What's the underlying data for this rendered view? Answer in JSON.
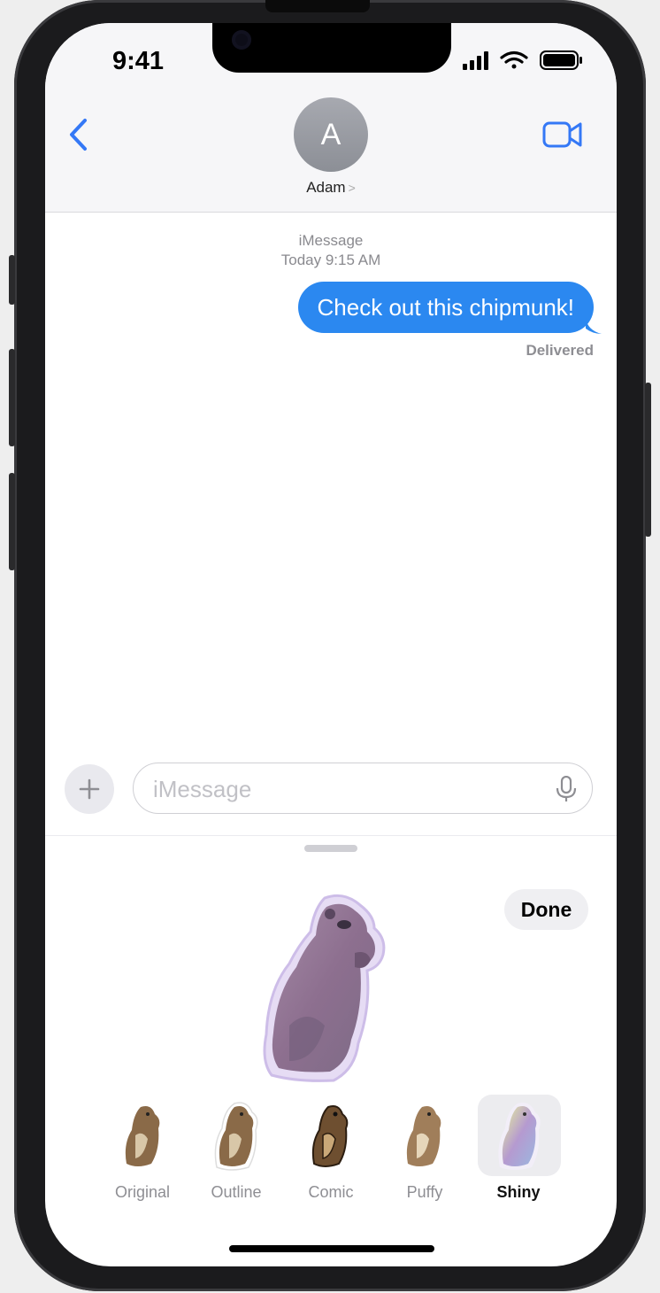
{
  "status_bar": {
    "time": "9:41"
  },
  "header": {
    "avatar_initial": "A",
    "contact_name": "Adam",
    "name_chevron": ">",
    "back_icon": "chevron-left-icon",
    "video_icon": "video-camera-icon"
  },
  "thread": {
    "service": "iMessage",
    "timestamp": "Today 9:15 AM",
    "messages": [
      {
        "text": "Check out this chipmunk!",
        "from": "me"
      }
    ],
    "status": "Delivered"
  },
  "composer": {
    "placeholder": "iMessage",
    "value": ""
  },
  "sticker_panel": {
    "done_label": "Done",
    "effects": [
      {
        "label": "Original",
        "selected": false
      },
      {
        "label": "Outline",
        "selected": false
      },
      {
        "label": "Comic",
        "selected": false
      },
      {
        "label": "Puffy",
        "selected": false
      },
      {
        "label": "Shiny",
        "selected": true
      }
    ]
  },
  "colors": {
    "accent": "#2b88f0",
    "bubble": "#2b88f0",
    "link": "#3478f6"
  }
}
